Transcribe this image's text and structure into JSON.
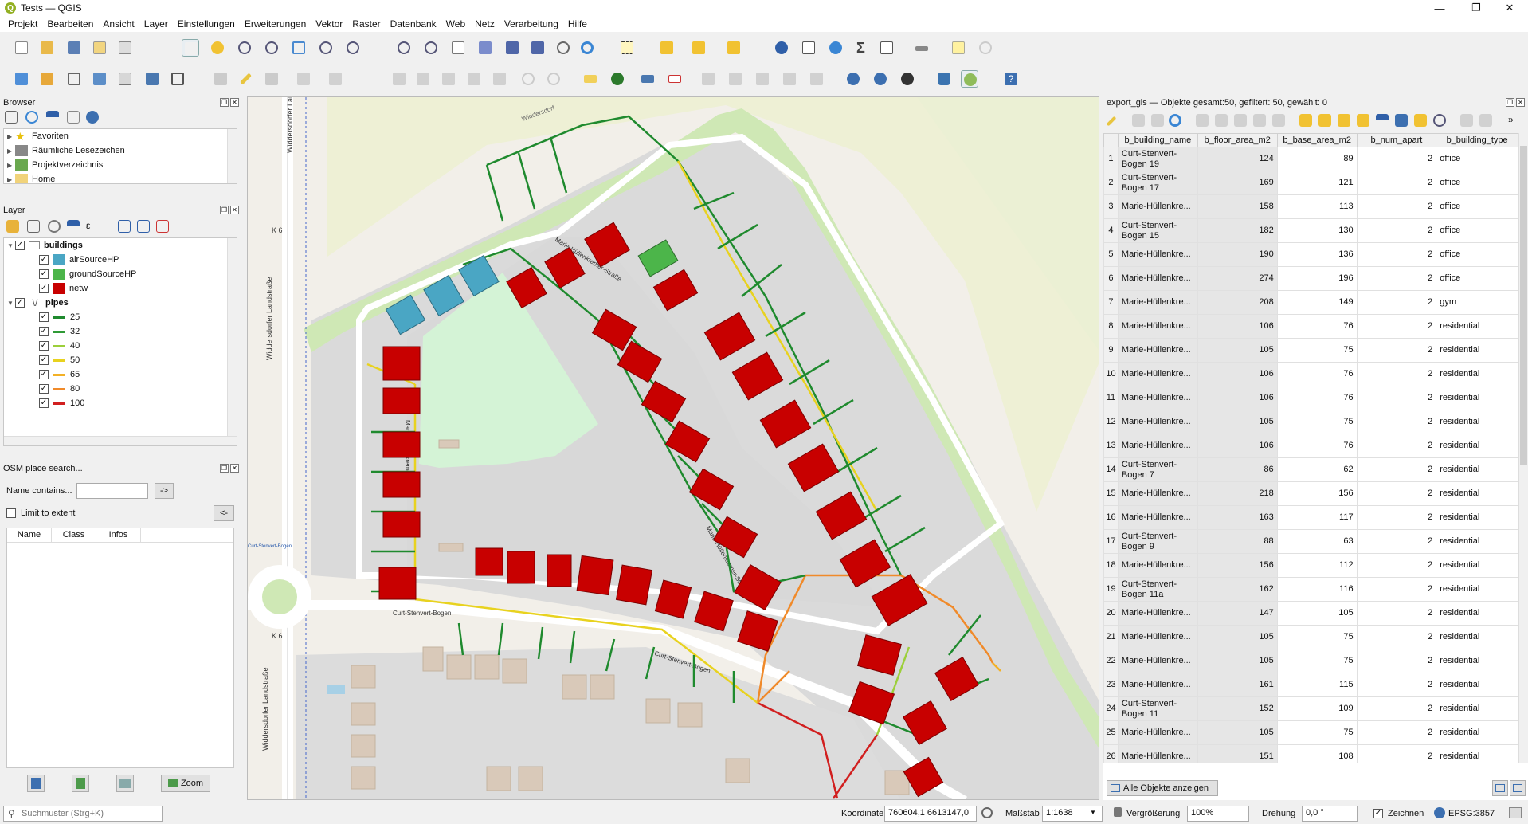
{
  "window": {
    "title": "Tests — QGIS",
    "controls": [
      "—",
      "❐",
      "✕"
    ]
  },
  "menu": [
    "Projekt",
    "Bearbeiten",
    "Ansicht",
    "Layer",
    "Einstellungen",
    "Erweiterungen",
    "Vektor",
    "Raster",
    "Datenbank",
    "Web",
    "Netz",
    "Verarbeitung",
    "Hilfe"
  ],
  "browser": {
    "title": "Browser",
    "items": [
      "Favoriten",
      "Räumliche Lesezeichen",
      "Projektverzeichnis",
      "Home"
    ]
  },
  "layers": {
    "title": "Layer",
    "groups": [
      {
        "name": "buildings",
        "items": [
          {
            "label": "airSourceHP",
            "color": "#4aa6c4"
          },
          {
            "label": "groundSourceHP",
            "color": "#4cb54a"
          },
          {
            "label": "netw",
            "color": "#c80000"
          }
        ]
      },
      {
        "name": "pipes",
        "items": [
          {
            "label": "25",
            "color": "#1f8a2e"
          },
          {
            "label": "32",
            "color": "#2f9a36"
          },
          {
            "label": "40",
            "color": "#9ccf3a"
          },
          {
            "label": "50",
            "color": "#e8d21f"
          },
          {
            "label": "65",
            "color": "#f3b126"
          },
          {
            "label": "80",
            "color": "#f08a2a"
          },
          {
            "label": "100",
            "color": "#d11f1f"
          }
        ]
      }
    ]
  },
  "osm": {
    "title": "OSM place search...",
    "name_label": "Name contains...",
    "name_value": "",
    "go_button": "->",
    "limit_label": "Limit to extent",
    "back_button": "<-",
    "columns": [
      "Name",
      "Class",
      "Infos"
    ],
    "zoom_button": "Zoom"
  },
  "map_labels": {
    "street1": "Widdersdorfer Landstraße",
    "street2": "Curt-Stenvert-Bogen",
    "street3": "Marie-Hüllenkremer-Straße",
    "k6": "K 6",
    "widdersdorf": "Widdersdorf",
    "csb_small": "Curt-Stenvert-Bogen"
  },
  "attribute_table": {
    "title": "export_gis — Objekte gesamt:50, gefiltert: 50, gewählt: 0",
    "columns": [
      "b_building_name",
      "b_floor_area_m2",
      "b_base_area_m2",
      "b_num_apart",
      "b_building_type"
    ],
    "rows": [
      [
        "1",
        "Curt-Stenvert-Bogen 19",
        "124",
        "89",
        "2",
        "office"
      ],
      [
        "2",
        "Curt-Stenvert-Bogen 17",
        "169",
        "121",
        "2",
        "office"
      ],
      [
        "3",
        "Marie-Hüllenkre...",
        "158",
        "113",
        "2",
        "office"
      ],
      [
        "4",
        "Curt-Stenvert-Bogen 15",
        "182",
        "130",
        "2",
        "office"
      ],
      [
        "5",
        "Marie-Hüllenkre...",
        "190",
        "136",
        "2",
        "office"
      ],
      [
        "6",
        "Marie-Hüllenkre...",
        "274",
        "196",
        "2",
        "office"
      ],
      [
        "7",
        "Marie-Hüllenkre...",
        "208",
        "149",
        "2",
        "gym"
      ],
      [
        "8",
        "Marie-Hüllenkre...",
        "106",
        "76",
        "2",
        "residential"
      ],
      [
        "9",
        "Marie-Hüllenkre...",
        "105",
        "75",
        "2",
        "residential"
      ],
      [
        "10",
        "Marie-Hüllenkre...",
        "106",
        "76",
        "2",
        "residential"
      ],
      [
        "11",
        "Marie-Hüllenkre...",
        "106",
        "76",
        "2",
        "residential"
      ],
      [
        "12",
        "Marie-Hüllenkre...",
        "105",
        "75",
        "2",
        "residential"
      ],
      [
        "13",
        "Marie-Hüllenkre...",
        "106",
        "76",
        "2",
        "residential"
      ],
      [
        "14",
        "Curt-Stenvert-Bogen 7",
        "86",
        "62",
        "2",
        "residential"
      ],
      [
        "15",
        "Marie-Hüllenkre...",
        "218",
        "156",
        "2",
        "residential"
      ],
      [
        "16",
        "Marie-Hüllenkre...",
        "163",
        "117",
        "2",
        "residential"
      ],
      [
        "17",
        "Curt-Stenvert-Bogen 9",
        "88",
        "63",
        "2",
        "residential"
      ],
      [
        "18",
        "Marie-Hüllenkre...",
        "156",
        "112",
        "2",
        "residential"
      ],
      [
        "19",
        "Curt-Stenvert-Bogen 11a",
        "162",
        "116",
        "2",
        "residential"
      ],
      [
        "20",
        "Marie-Hüllenkre...",
        "147",
        "105",
        "2",
        "residential"
      ],
      [
        "21",
        "Marie-Hüllenkre...",
        "105",
        "75",
        "2",
        "residential"
      ],
      [
        "22",
        "Marie-Hüllenkre...",
        "105",
        "75",
        "2",
        "residential"
      ],
      [
        "23",
        "Marie-Hüllenkre...",
        "161",
        "115",
        "2",
        "residential"
      ],
      [
        "24",
        "Curt-Stenvert-Bogen 11",
        "152",
        "109",
        "2",
        "residential"
      ],
      [
        "25",
        "Marie-Hüllenkre...",
        "105",
        "75",
        "2",
        "residential"
      ],
      [
        "26",
        "Marie-Hüllenkre...",
        "151",
        "108",
        "2",
        "residential"
      ]
    ],
    "show_all_button": "Alle Objekte anzeigen"
  },
  "status": {
    "search_placeholder": "Suchmuster (Strg+K)",
    "coord_label": "Koordinate",
    "coord_value": "760604,1  6613147,0",
    "scale_label": "Maßstab",
    "scale_value": "1:1638",
    "magnifier_label": "Vergrößerung",
    "magnifier_value": "100%",
    "rotation_label": "Drehung",
    "rotation_value": "0,0 °",
    "render_label": "Zeichnen",
    "crs": "EPSG:3857"
  }
}
